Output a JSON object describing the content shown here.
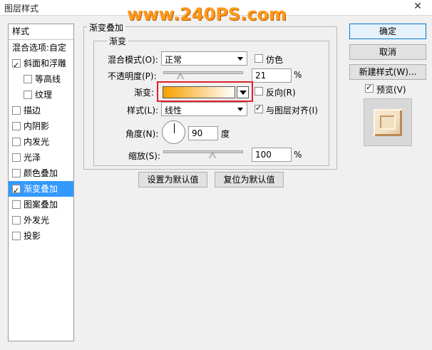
{
  "window": {
    "title": "图层样式",
    "close_glyph": "✕",
    "watermark": "www.240PS.com"
  },
  "sidebar": {
    "header": "样式",
    "items": [
      {
        "label": "混合选项:自定",
        "checkbox": false,
        "checked": false,
        "selected": false,
        "indent": 0
      },
      {
        "label": "斜面和浮雕",
        "checkbox": true,
        "checked": true,
        "selected": false,
        "indent": 0
      },
      {
        "label": "等高线",
        "checkbox": true,
        "checked": false,
        "selected": false,
        "indent": 1
      },
      {
        "label": "纹理",
        "checkbox": true,
        "checked": false,
        "selected": false,
        "indent": 1
      },
      {
        "label": "描边",
        "checkbox": true,
        "checked": false,
        "selected": false,
        "indent": 0
      },
      {
        "label": "内阴影",
        "checkbox": true,
        "checked": false,
        "selected": false,
        "indent": 0
      },
      {
        "label": "内发光",
        "checkbox": true,
        "checked": false,
        "selected": false,
        "indent": 0
      },
      {
        "label": "光泽",
        "checkbox": true,
        "checked": false,
        "selected": false,
        "indent": 0
      },
      {
        "label": "颜色叠加",
        "checkbox": true,
        "checked": false,
        "selected": false,
        "indent": 0
      },
      {
        "label": "渐变叠加",
        "checkbox": true,
        "checked": true,
        "selected": true,
        "indent": 0
      },
      {
        "label": "图案叠加",
        "checkbox": true,
        "checked": false,
        "selected": false,
        "indent": 0
      },
      {
        "label": "外发光",
        "checkbox": true,
        "checked": false,
        "selected": false,
        "indent": 0
      },
      {
        "label": "投影",
        "checkbox": true,
        "checked": false,
        "selected": false,
        "indent": 0
      }
    ]
  },
  "panel": {
    "group_title": "渐变叠加",
    "subgroup_title": "渐变",
    "blend_mode": {
      "label": "混合模式(O):",
      "value": "正常",
      "dither_label": "仿色",
      "dither_checked": false
    },
    "opacity": {
      "label": "不透明度(P):",
      "value": "21",
      "unit": "%",
      "level": 0.21
    },
    "gradient": {
      "label": "渐变:",
      "reverse_label": "反向(R)",
      "reverse_checked": false,
      "color_start": "#f7a000",
      "color_end": "#ffffff"
    },
    "style": {
      "label": "样式(L):",
      "value": "线性",
      "align_label": "与图层对齐(I)",
      "align_checked": true
    },
    "angle": {
      "label": "角度(N):",
      "value": "90",
      "unit": "度"
    },
    "scale": {
      "label": "缩放(S):",
      "value": "100",
      "unit": "%",
      "level": 0.5
    },
    "make_default_label": "设置为默认值",
    "reset_default_label": "复位为默认值"
  },
  "actions": {
    "ok_label": "确定",
    "cancel_label": "取消",
    "new_style_label": "新建样式(W)...",
    "preview_label": "预览(V)",
    "preview_checked": true
  }
}
